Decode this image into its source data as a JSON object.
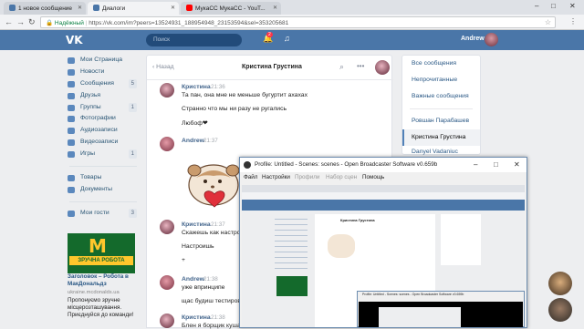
{
  "browser": {
    "tabs": [
      {
        "label": "1 новое сообщение",
        "color": "#4a76a8"
      },
      {
        "label": "Диалоги",
        "color": "#4a76a8"
      },
      {
        "label": "МукаСС МукаСС - YouT...",
        "color": "#ff0000"
      }
    ],
    "secure_label": "Надёжный",
    "url": "https://vk.com/im?peers=13524931_188954948_23153594&sel=353205681"
  },
  "vk": {
    "logo": "VK",
    "search_placeholder": "Поиск",
    "notifications_count": "2",
    "user_name": "Andrew"
  },
  "left_menu": {
    "items": [
      {
        "label": "Мои Страница",
        "count": ""
      },
      {
        "label": "Новости",
        "count": ""
      },
      {
        "label": "Сообщения",
        "count": "5"
      },
      {
        "label": "Друзья",
        "count": ""
      },
      {
        "label": "Группы",
        "count": "1"
      },
      {
        "label": "Фотографии",
        "count": ""
      },
      {
        "label": "Аудиозаписи",
        "count": ""
      },
      {
        "label": "Видеозаписи",
        "count": ""
      },
      {
        "label": "Игры",
        "count": "1"
      }
    ],
    "items2": [
      {
        "label": "Товары",
        "count": ""
      },
      {
        "label": "Документы",
        "count": ""
      }
    ],
    "items3": [
      {
        "label": "Мои гости",
        "count": "3"
      }
    ],
    "ad": {
      "logo": "M",
      "band": "ЗРУЧНА РОБОТА",
      "title": "Заголовок – Робота в МакДональдз",
      "url": "ukraine.mcdonalds.ua",
      "text": "Пропонуємо зручне місцерозташування. Приєднуйся до команди!"
    }
  },
  "dialog": {
    "back_label": "Назад",
    "peer_name": "Кристина Грустина",
    "messages": [
      {
        "author": "Кристина",
        "time": "21:36",
        "lines": [
          "Та пан, она мне не меньше бугуртит ахахах",
          "Странно что мы ни разу не ругались",
          "Любоф❤"
        ]
      },
      {
        "author": "Andrew",
        "time": "21:37",
        "lines": []
      },
      {
        "author": "Кристина",
        "time": "21:37",
        "lines": [
          "Скажешь как настрои",
          "Настроишь",
          "+"
        ]
      },
      {
        "author": "Andrew",
        "time": "21:38",
        "lines": [
          "уже впринципе",
          "щас будиш тестиров"
        ]
      },
      {
        "author": "Кристина",
        "time": "21:38",
        "lines": [
          "Блен я борщик куша"
        ]
      }
    ]
  },
  "right_panel": {
    "items": [
      "Все сообщения",
      "Непрочитанные",
      "Важные сообщения"
    ],
    "dialogs": [
      "Ровшан Парабашев",
      "Кристина Грустина",
      "Danyel Vadaniuc"
    ]
  },
  "obs": {
    "title": "Profile: Untitled - Scenes: scenes - Open Broadcaster Software v0.659b",
    "menu": [
      "Файл",
      "Настройки",
      "Профили",
      "Набор сцен",
      "Помощь"
    ],
    "nested_peer": "Кристина Грустина",
    "nested_title": "Profile: Untitled - Scenes: scenes - Open Broadcaster Software v0.659b"
  },
  "colors": {
    "vk_blue": "#4a76a8",
    "link": "#2a5885",
    "mcd_green": "#146a2c",
    "mcd_yellow": "#ffc72c"
  }
}
